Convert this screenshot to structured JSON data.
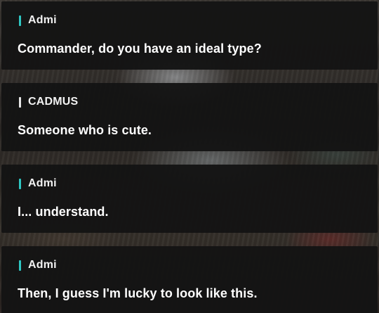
{
  "dialogue_log": [
    {
      "speaker": "Admi",
      "text": "Commander, do you have an ideal type?",
      "accent": "#2ec6c2"
    },
    {
      "speaker": "CADMUS",
      "text": "Someone who is cute.",
      "accent": "#e6e6e6"
    },
    {
      "speaker": "Admi",
      "text": "I... understand.",
      "accent": "#2ec6c2"
    },
    {
      "speaker": "Admi",
      "text": "Then, I guess I'm lucky to look like this.",
      "accent": "#2ec6c2"
    }
  ]
}
